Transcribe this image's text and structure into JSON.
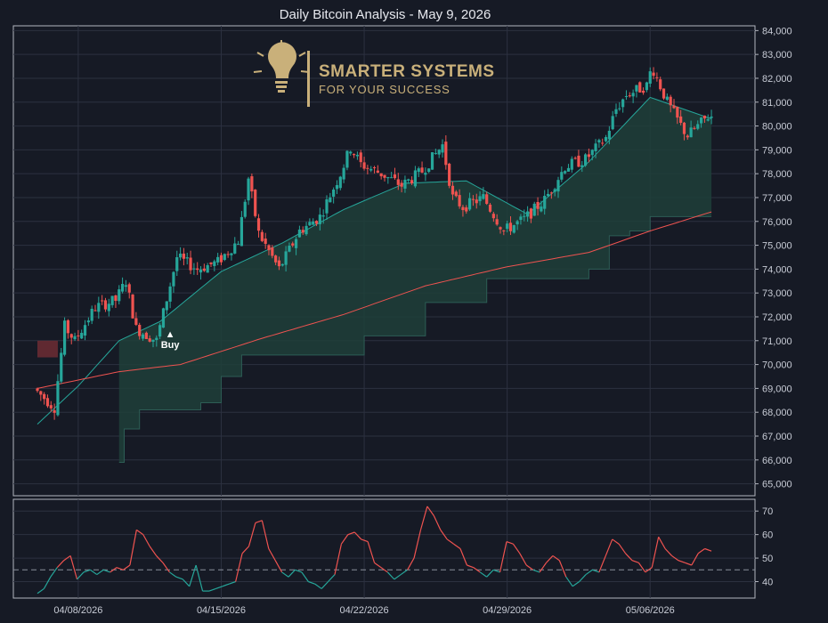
{
  "chart_data": [
    {
      "type": "candlestick",
      "title": "Daily Bitcoin Analysis - May 9, 2026",
      "ylim": [
        64500,
        84200
      ],
      "yticks": [
        65000,
        66000,
        67000,
        68000,
        69000,
        70000,
        71000,
        72000,
        73000,
        74000,
        75000,
        76000,
        77000,
        78000,
        79000,
        80000,
        81000,
        82000,
        83000,
        84000
      ],
      "ytick_labels": [
        "65,000",
        "66,000",
        "67,000",
        "68,000",
        "69,000",
        "70,000",
        "71,000",
        "72,000",
        "73,000",
        "74,000",
        "75,000",
        "76,000",
        "77,000",
        "78,000",
        "79,000",
        "80,000",
        "81,000",
        "82,000",
        "83,000",
        "84,000"
      ],
      "x_start": "2026-04-06",
      "x_end": "2026-05-10",
      "xtick_labels": [
        "04/08/2026",
        "04/15/2026",
        "04/22/2026",
        "04/29/2026",
        "05/06/2026"
      ],
      "xtick_dates": [
        "2026-04-08",
        "2026-04-15",
        "2026-04-22",
        "2026-04-29",
        "2026-05-06"
      ],
      "price_path": [
        [
          "2026-04-06",
          69000
        ],
        [
          "2026-04-07",
          68200
        ],
        [
          "2026-04-07T12",
          71600
        ],
        [
          "2026-04-08",
          71000
        ],
        [
          "2026-04-09",
          72400
        ],
        [
          "2026-04-10",
          72700
        ],
        [
          "2026-04-10T12",
          73500
        ],
        [
          "2026-04-11",
          71500
        ],
        [
          "2026-04-12",
          71000
        ],
        [
          "2026-04-13",
          74500
        ],
        [
          "2026-04-14",
          74000
        ],
        [
          "2026-04-15",
          74300
        ],
        [
          "2026-04-16",
          75200
        ],
        [
          "2026-04-16T12",
          77800
        ],
        [
          "2026-04-17",
          75500
        ],
        [
          "2026-04-18",
          74000
        ],
        [
          "2026-04-19",
          75600
        ],
        [
          "2026-04-20",
          76200
        ],
        [
          "2026-04-21",
          78000
        ],
        [
          "2026-04-21T12",
          79100
        ],
        [
          "2026-04-22",
          78400
        ],
        [
          "2026-04-23",
          78000
        ],
        [
          "2026-04-24",
          77500
        ],
        [
          "2026-04-25",
          78100
        ],
        [
          "2026-04-26",
          79200
        ],
        [
          "2026-04-26T12",
          77000
        ],
        [
          "2026-04-27",
          76600
        ],
        [
          "2026-04-28",
          77000
        ],
        [
          "2026-04-29",
          75600
        ],
        [
          "2026-04-30",
          76100
        ],
        [
          "2026-05-01",
          76900
        ],
        [
          "2026-05-02",
          78300
        ],
        [
          "2026-05-03",
          78600
        ],
        [
          "2026-05-04",
          79500
        ],
        [
          "2026-05-04T12",
          80700
        ],
        [
          "2026-05-05",
          81300
        ],
        [
          "2026-05-06",
          81700
        ],
        [
          "2026-05-06T06",
          82500
        ],
        [
          "2026-05-07",
          81000
        ],
        [
          "2026-05-07T18",
          79900
        ],
        [
          "2026-05-08",
          79600
        ],
        [
          "2026-05-08T18",
          80200
        ],
        [
          "2026-05-09",
          80400
        ]
      ],
      "series": [
        {
          "name": "",
          "style": "sma-fast",
          "color": "#26a69a",
          "x": [
            "2026-04-06",
            "2026-04-08",
            "2026-04-10",
            "2026-04-12",
            "2026-04-15",
            "2026-04-18",
            "2026-04-21",
            "2026-04-24",
            "2026-04-27",
            "2026-04-30",
            "2026-05-03",
            "2026-05-06",
            "2026-05-09"
          ],
          "values": [
            67500,
            69100,
            71000,
            71800,
            73900,
            75100,
            76500,
            77600,
            77700,
            76300,
            78500,
            81200,
            80300
          ]
        },
        {
          "name": "",
          "style": "sma-slow",
          "color": "#ef5350",
          "x": [
            "2026-04-06",
            "2026-04-10",
            "2026-04-13",
            "2026-04-17",
            "2026-04-21",
            "2026-04-25",
            "2026-04-29",
            "2026-05-03",
            "2026-05-06",
            "2026-05-09"
          ],
          "values": [
            69000,
            69700,
            70000,
            71100,
            72100,
            73300,
            74100,
            74700,
            75600,
            76400
          ]
        }
      ],
      "support_band": [
        [
          "2026-04-10",
          65900
        ],
        [
          "2026-04-10T06",
          67300
        ],
        [
          "2026-04-11",
          68100
        ],
        [
          "2026-04-14",
          68400
        ],
        [
          "2026-04-15",
          69500
        ],
        [
          "2026-04-16",
          70400
        ],
        [
          "2026-04-18",
          70400
        ],
        [
          "2026-04-22",
          71200
        ],
        [
          "2026-04-25",
          72600
        ],
        [
          "2026-04-28",
          73600
        ],
        [
          "2026-05-03",
          74000
        ],
        [
          "2026-05-04",
          75400
        ],
        [
          "2026-05-05",
          75600
        ],
        [
          "2026-05-06",
          76200
        ],
        [
          "2026-05-09",
          76200
        ]
      ],
      "resistance_box": {
        "x": [
          "2026-04-06",
          "2026-04-07"
        ],
        "y": [
          70300,
          71000
        ]
      },
      "annotations": [
        {
          "text": "Buy",
          "date": "2026-04-12T12",
          "price": 71100,
          "symbol": "▲"
        }
      ]
    },
    {
      "type": "line",
      "title": "",
      "ylim": [
        33,
        75
      ],
      "yticks": [
        40,
        50,
        60,
        70
      ],
      "ytick_labels": [
        "40",
        "50",
        "60",
        "70"
      ],
      "threshold": 45,
      "colors": {
        "above": "#ef5350",
        "below": "#26a69a"
      },
      "x_start": "2026-04-06",
      "x_end": "2026-05-09",
      "values": [
        35,
        37,
        42,
        46,
        49,
        51,
        41,
        44,
        45,
        43,
        45,
        44,
        46,
        45,
        47,
        62,
        60,
        55,
        51,
        48,
        44,
        42,
        41,
        38,
        47,
        36,
        36,
        37,
        38,
        39,
        40,
        52,
        55,
        65,
        66,
        54,
        49,
        44,
        42,
        45,
        44,
        40,
        39,
        37,
        40,
        43,
        56,
        60,
        61,
        58,
        57,
        48,
        46,
        44,
        41,
        43,
        45,
        50,
        62,
        72,
        68,
        62,
        58,
        56,
        54,
        47,
        46,
        44,
        42,
        45,
        44,
        57,
        56,
        52,
        47,
        45,
        44,
        48,
        51,
        49,
        42,
        38,
        40,
        43,
        45,
        44,
        51,
        58,
        56,
        52,
        49,
        48,
        44,
        46,
        59,
        54,
        51,
        49,
        48,
        47,
        52,
        54,
        53
      ]
    }
  ],
  "colors": {
    "background": "#161a25",
    "up": "#26a69a",
    "down": "#ef5350",
    "band_fill": "#1f3f3a",
    "grid": "#2c3140"
  },
  "logo": {
    "line1": "SMARTER SYSTEMS",
    "line2": "FOR YOUR SUCCESS",
    "icon": "lightbulb-icon"
  }
}
